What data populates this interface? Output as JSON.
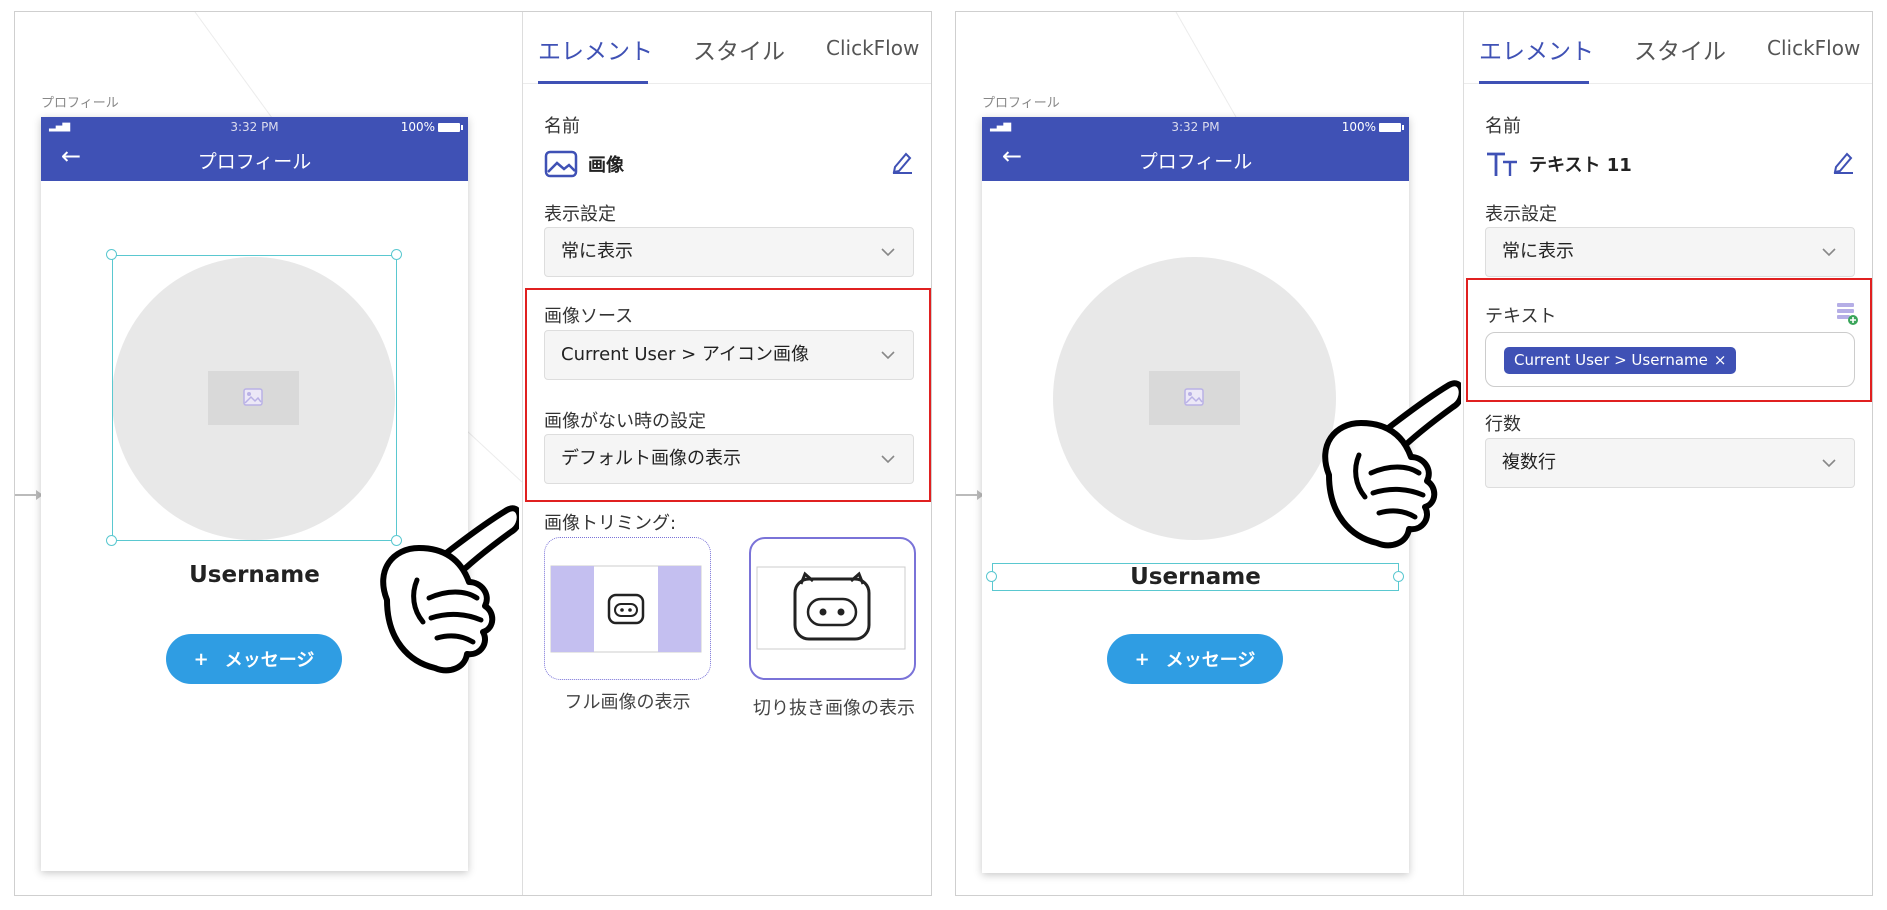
{
  "colors": {
    "primary": "#3f51b5",
    "button_blue": "#2f9de3",
    "selection": "#5ac8d0",
    "highlight_red": "#e02020",
    "trim_purple": "#7a73d8"
  },
  "left": {
    "canvas_label": "プロフィール",
    "phone": {
      "time": "3:32 PM",
      "battery": "100%",
      "title": "プロフィール",
      "username": "Username",
      "message_plus": "+",
      "message_label": "メッセージ"
    },
    "tabs": {
      "element": "エレメント",
      "style": "スタイル",
      "clickflow": "ClickFlow"
    },
    "name_label": "名前",
    "name_value": "画像",
    "display_label": "表示設定",
    "display_value": "常に表示",
    "image_source_label": "画像ソース",
    "image_source_value": "Current User > アイコン画像",
    "no_image_label": "画像がない時の設定",
    "no_image_value": "デフォルト画像の表示",
    "trimming_label": "画像トリミング:",
    "trim_full": "フル画像の表示",
    "trim_crop": "切り抜き画像の表示"
  },
  "right": {
    "canvas_label": "プロフィール",
    "phone": {
      "time": "3:32 PM",
      "battery": "100%",
      "title": "プロフィール",
      "username": "Username",
      "message_plus": "+",
      "message_label": "メッセージ"
    },
    "tabs": {
      "element": "エレメント",
      "style": "スタイル",
      "clickflow": "ClickFlow"
    },
    "name_label": "名前",
    "name_value": "テキスト 11",
    "display_label": "表示設定",
    "display_value": "常に表示",
    "text_label": "テキスト",
    "text_chip": "Current User > Username",
    "text_chip_close": "×",
    "lines_label": "行数",
    "lines_value": "複数行"
  }
}
